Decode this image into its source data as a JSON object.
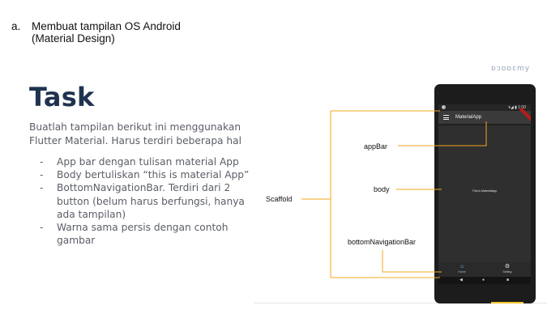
{
  "heading": {
    "marker": "a.",
    "line1": "Membuat tampilan OS Android",
    "line2": "(Material Design)"
  },
  "slide": {
    "watermark": "ɒɔɒɒɛmy",
    "title": "Task",
    "description": "Buatlah tampilan berikut ini menggunakan Flutter Material. Harus terdiri beberapa hal",
    "bullets": [
      "App bar dengan tulisan material App",
      "Body bertuliskan “this is material App”",
      "BottomNavigationBar. Terdiri dari 2 button (belum harus berfungsi, hanya ada tampilan)",
      "Warna sama persis dengan contoh gambar"
    ],
    "bullet_marker": "-"
  },
  "phone": {
    "app_title": "MaterialApp",
    "body_text": "This is MaterialApp",
    "status_right": "▾◢ ▮ 1:00",
    "nav_items": [
      {
        "label": "Home",
        "icon": "home-icon",
        "glyph": "⌂"
      },
      {
        "label": "Setting",
        "icon": "gear-icon",
        "glyph": "⚙"
      }
    ],
    "system_nav": [
      "◀",
      "●",
      "■"
    ],
    "colors": {
      "screen_bg": "#2f2f2f",
      "appbar_bg": "#3a3a3a",
      "active_nav": "#7fc7ff",
      "debug_badge": "#b71c1c"
    }
  },
  "annotations": {
    "scaffold": "Scaffold",
    "appbar": "appBar",
    "body": "body",
    "bottom_nav": "bottomNavigationBar",
    "line_color": "#f0a81c"
  }
}
